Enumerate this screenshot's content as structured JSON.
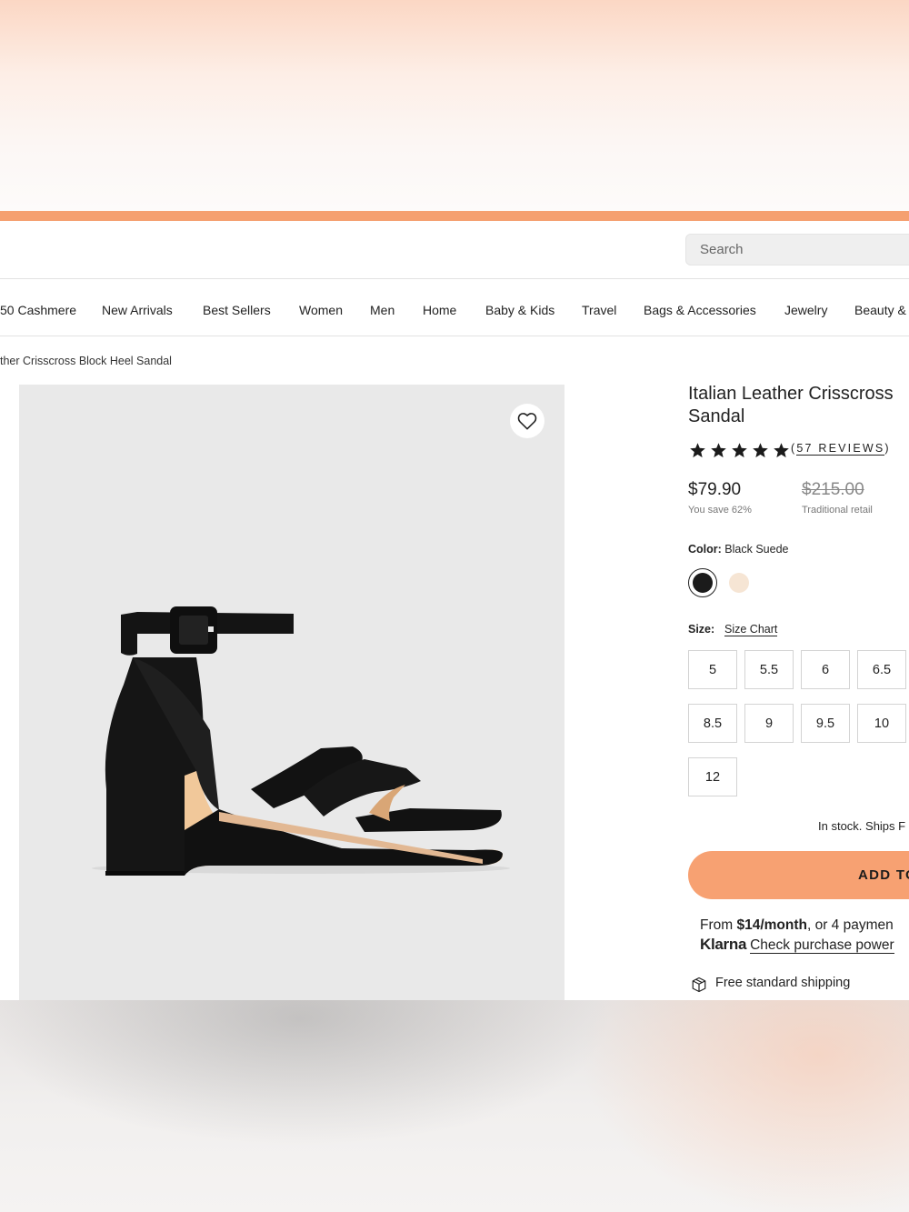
{
  "header": {
    "search_placeholder": "Search"
  },
  "nav": {
    "items": [
      "50 Cashmere",
      "New Arrivals",
      "Best Sellers",
      "Women",
      "Men",
      "Home",
      "Baby & Kids",
      "Travel",
      "Bags & Accessories",
      "Jewelry",
      "Beauty &"
    ]
  },
  "breadcrumb": "ther Crisscross Block Heel Sandal",
  "product": {
    "title_line1": "Italian Leather Crisscross",
    "title_line2": "Sandal",
    "rating": 5,
    "reviews_label": "57 REVIEWS",
    "price": "$79.90",
    "savings": "You save 62%",
    "original_price": "$215.00",
    "original_label": "Traditional retail",
    "color_label": "Color:",
    "color_value": "Black Suede",
    "colors": [
      "#1b1b1b",
      "#f6e5d4"
    ],
    "size_label": "Size:",
    "size_chart_label": "Size Chart",
    "sizes": [
      "5",
      "5.5",
      "6",
      "6.5",
      "8.5",
      "9",
      "9.5",
      "10",
      "12"
    ],
    "stock_text": "In stock. Ships F",
    "add_button": "ADD TO",
    "klarna_prefix": "From ",
    "klarna_amount": "$14/month",
    "klarna_suffix": ", or 4 paymen",
    "klarna_brand": "Klarna",
    "klarna_link": "Check purchase power",
    "shipping_text": "Free standard shipping"
  },
  "colors": {
    "accent": "#f7a172",
    "promo_bar": "#f5a070",
    "gallery_bg": "#e9e9e9"
  },
  "icons": [
    "heart-icon",
    "star-icon",
    "box-icon"
  ]
}
